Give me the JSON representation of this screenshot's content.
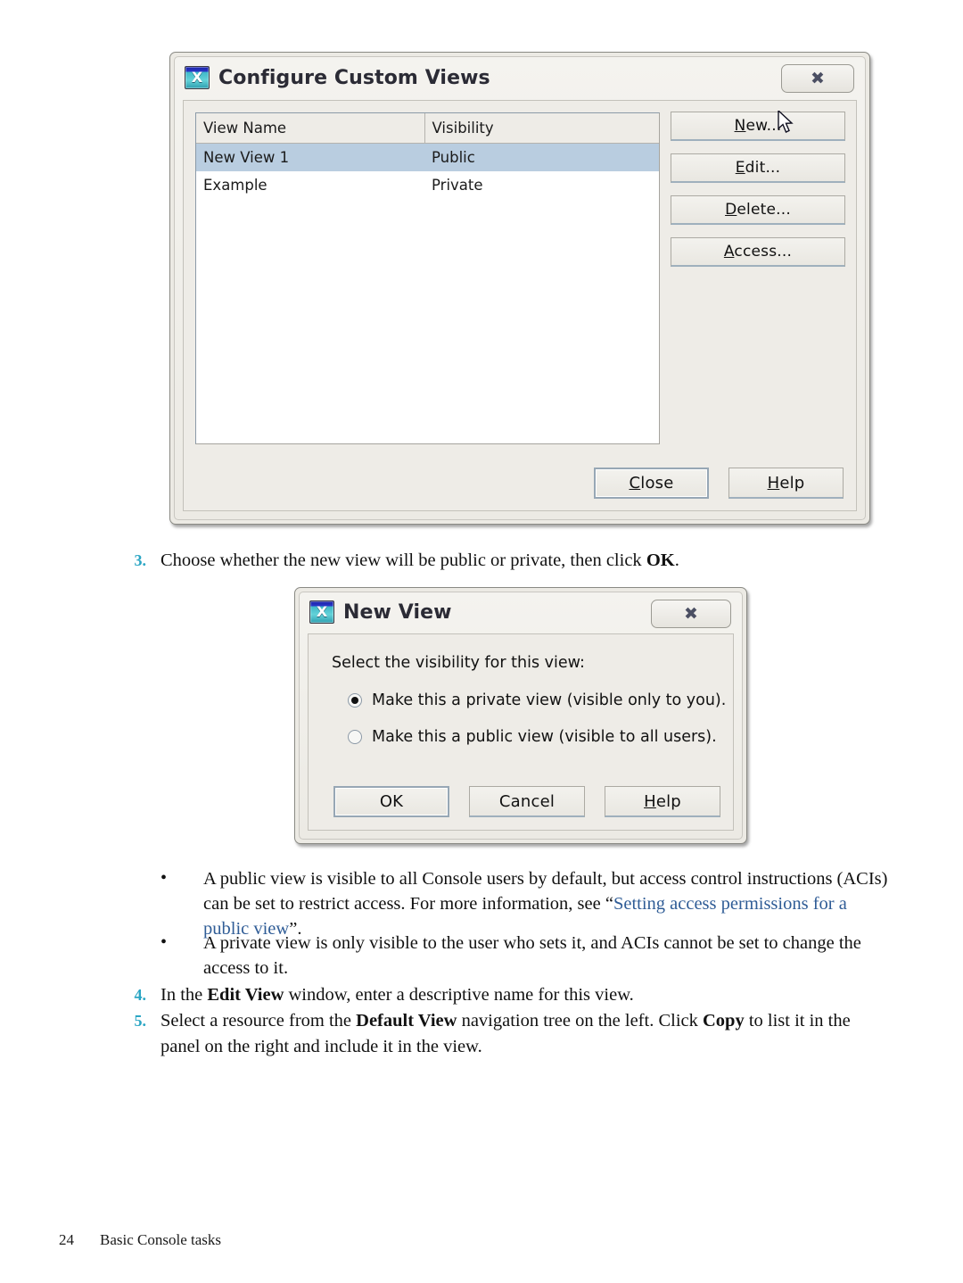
{
  "page": {
    "footer_page_number": "24",
    "footer_title": "Basic Console tasks"
  },
  "dialog_configure": {
    "title": "Configure Custom Views",
    "icon": "x-window-icon",
    "close_glyph": "✖",
    "table": {
      "columns": [
        "View Name",
        "Visibility"
      ],
      "rows": [
        {
          "name": "New View 1",
          "visibility": "Public",
          "selected": true
        },
        {
          "name": "Example",
          "visibility": "Private",
          "selected": false
        }
      ]
    },
    "side_buttons": [
      {
        "label": "New...",
        "mnemonic": "N"
      },
      {
        "label": "Edit...",
        "mnemonic": "E"
      },
      {
        "label": "Delete...",
        "mnemonic": "D"
      },
      {
        "label": "Access...",
        "mnemonic": "A"
      }
    ],
    "bottom_buttons": [
      {
        "label": "Close",
        "mnemonic": "C",
        "default": true
      },
      {
        "label": "Help",
        "mnemonic": "H",
        "default": false
      }
    ]
  },
  "dialog_newview": {
    "title": "New View",
    "icon": "x-window-icon",
    "close_glyph": "✖",
    "prompt": "Select the visibility for this view:",
    "options": [
      {
        "label": "Make this a private view (visible only to you).",
        "selected": true
      },
      {
        "label": "Make this a public view (visible to all users).",
        "selected": false
      }
    ],
    "buttons": [
      {
        "label": "OK",
        "default": true
      },
      {
        "label": "Cancel",
        "default": false
      },
      {
        "label": "Help",
        "mnemonic": "H",
        "default": false
      }
    ]
  },
  "steps": [
    {
      "number": "3.",
      "text_before": "Choose whether the new view will be public or private, then click ",
      "bold": "OK",
      "text_after": "."
    },
    {
      "number": "4.",
      "text_before": "In the ",
      "bold": "Edit View",
      "text_after": " window, enter a descriptive name for this view."
    }
  ],
  "step5": {
    "number": "5.",
    "part1": "Select a resource from the ",
    "bold1": "Default View",
    "part2": " navigation tree on the left. Click ",
    "bold2": "Copy",
    "part3": " to list it in the panel on the right and include it in the view."
  },
  "bullets": [
    {
      "marker": "•",
      "text_before": "A public view is visible to all Console users by default, but access control instructions (ACIs) can be set to restrict access. For more information, see “",
      "link": "Setting access permissions for a public view",
      "text_after": "”."
    },
    {
      "marker": "•",
      "text_before": "A private view is only visible to the user who sets it, and ACIs cannot be set to change the access to it.",
      "link": "",
      "text_after": ""
    }
  ]
}
